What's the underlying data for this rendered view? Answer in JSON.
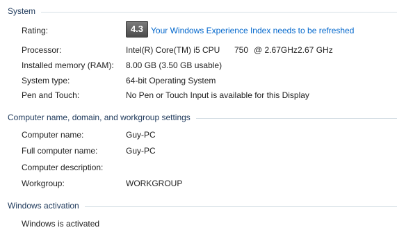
{
  "system": {
    "title": "System",
    "rating": {
      "label": "Rating:",
      "score": "4.3",
      "link_text": "Your Windows Experience Index needs to be refreshed"
    },
    "processor": {
      "label": "Processor:",
      "model": "Intel(R) Core(TM) i5 CPU",
      "number": "750",
      "speed1": "@ 2.67GHz",
      "speed2": "2.67 GHz"
    },
    "memory": {
      "label": "Installed memory (RAM):",
      "value": "8.00 GB (3.50 GB usable)"
    },
    "system_type": {
      "label": "System type:",
      "value": "64-bit Operating System"
    },
    "pen_touch": {
      "label": "Pen and Touch:",
      "value": "No Pen or Touch Input is available for this Display"
    }
  },
  "computer": {
    "title": "Computer name, domain, and workgroup settings",
    "name": {
      "label": "Computer name:",
      "value": "Guy-PC"
    },
    "full_name": {
      "label": "Full computer name:",
      "value": "Guy-PC"
    },
    "description": {
      "label": "Computer description:",
      "value": ""
    },
    "workgroup": {
      "label": "Workgroup:",
      "value": "WORKGROUP"
    }
  },
  "activation": {
    "title": "Windows activation",
    "status": "Windows is activated"
  },
  "colors": {
    "link": "#0066cc",
    "section_title": "#1e395b",
    "rule": "#d5dfe5"
  }
}
